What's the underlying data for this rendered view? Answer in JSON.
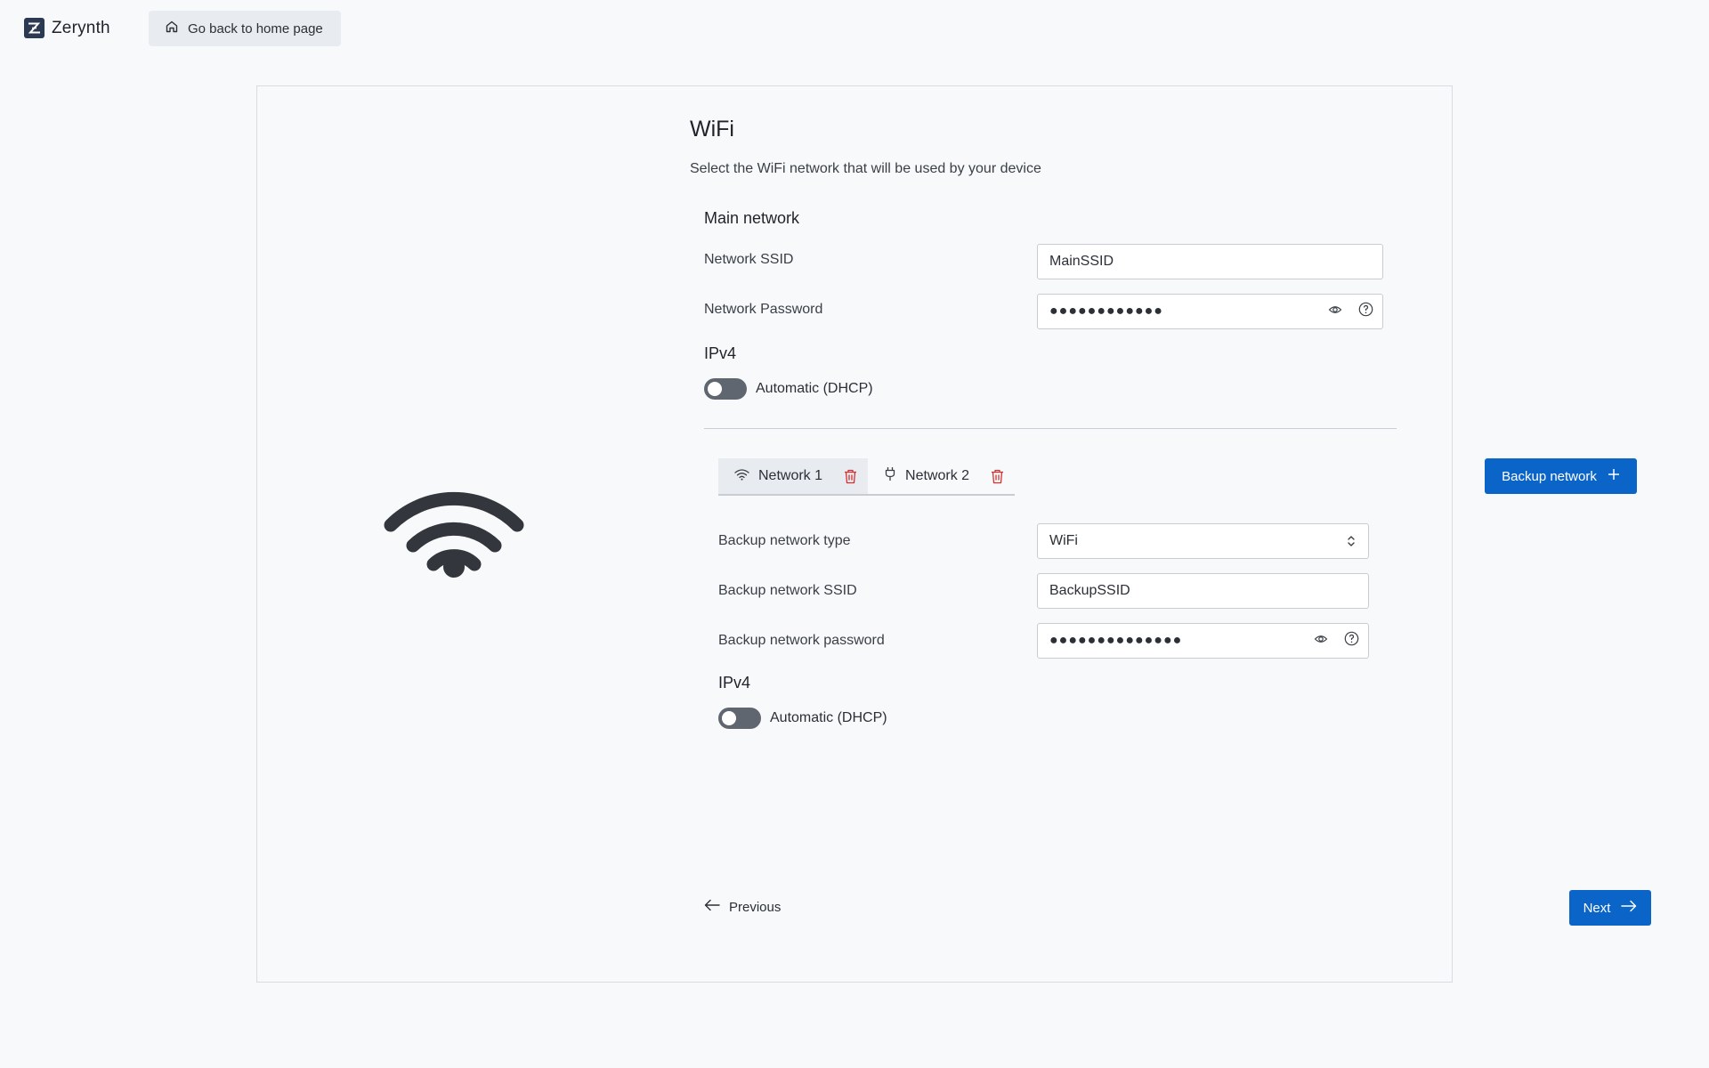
{
  "app": {
    "name": "Zerynth"
  },
  "topbar": {
    "home_label": "Go back to home page"
  },
  "page": {
    "title": "WiFi",
    "subtitle": "Select the WiFi network that will be used by your device"
  },
  "main_network": {
    "heading": "Main network",
    "ssid_label": "Network SSID",
    "ssid_value": "MainSSID",
    "password_label": "Network Password",
    "password_dots": "●●●●●●●●●●●●",
    "ipv4_heading": "IPv4",
    "dhcp_label": "Automatic (DHCP)",
    "dhcp_on": false
  },
  "backup_tabs": [
    {
      "label": "Network 1",
      "icon": "wifi-icon",
      "active": true
    },
    {
      "label": "Network 2",
      "icon": "plug-icon",
      "active": false
    }
  ],
  "backup_button_label": "Backup network",
  "backup_network": {
    "type_label": "Backup network type",
    "type_value": "WiFi",
    "ssid_label": "Backup network SSID",
    "ssid_value": "BackupSSID",
    "password_label": "Backup network password",
    "password_dots": "●●●●●●●●●●●●●●",
    "ipv4_heading": "IPv4",
    "dhcp_label": "Automatic (DHCP)",
    "dhcp_on": false
  },
  "footer": {
    "previous_label": "Previous",
    "next_label": "Next"
  },
  "colors": {
    "primary": "#0b64c8",
    "danger": "#d32f2f",
    "toggle_off": "#5f6670"
  }
}
